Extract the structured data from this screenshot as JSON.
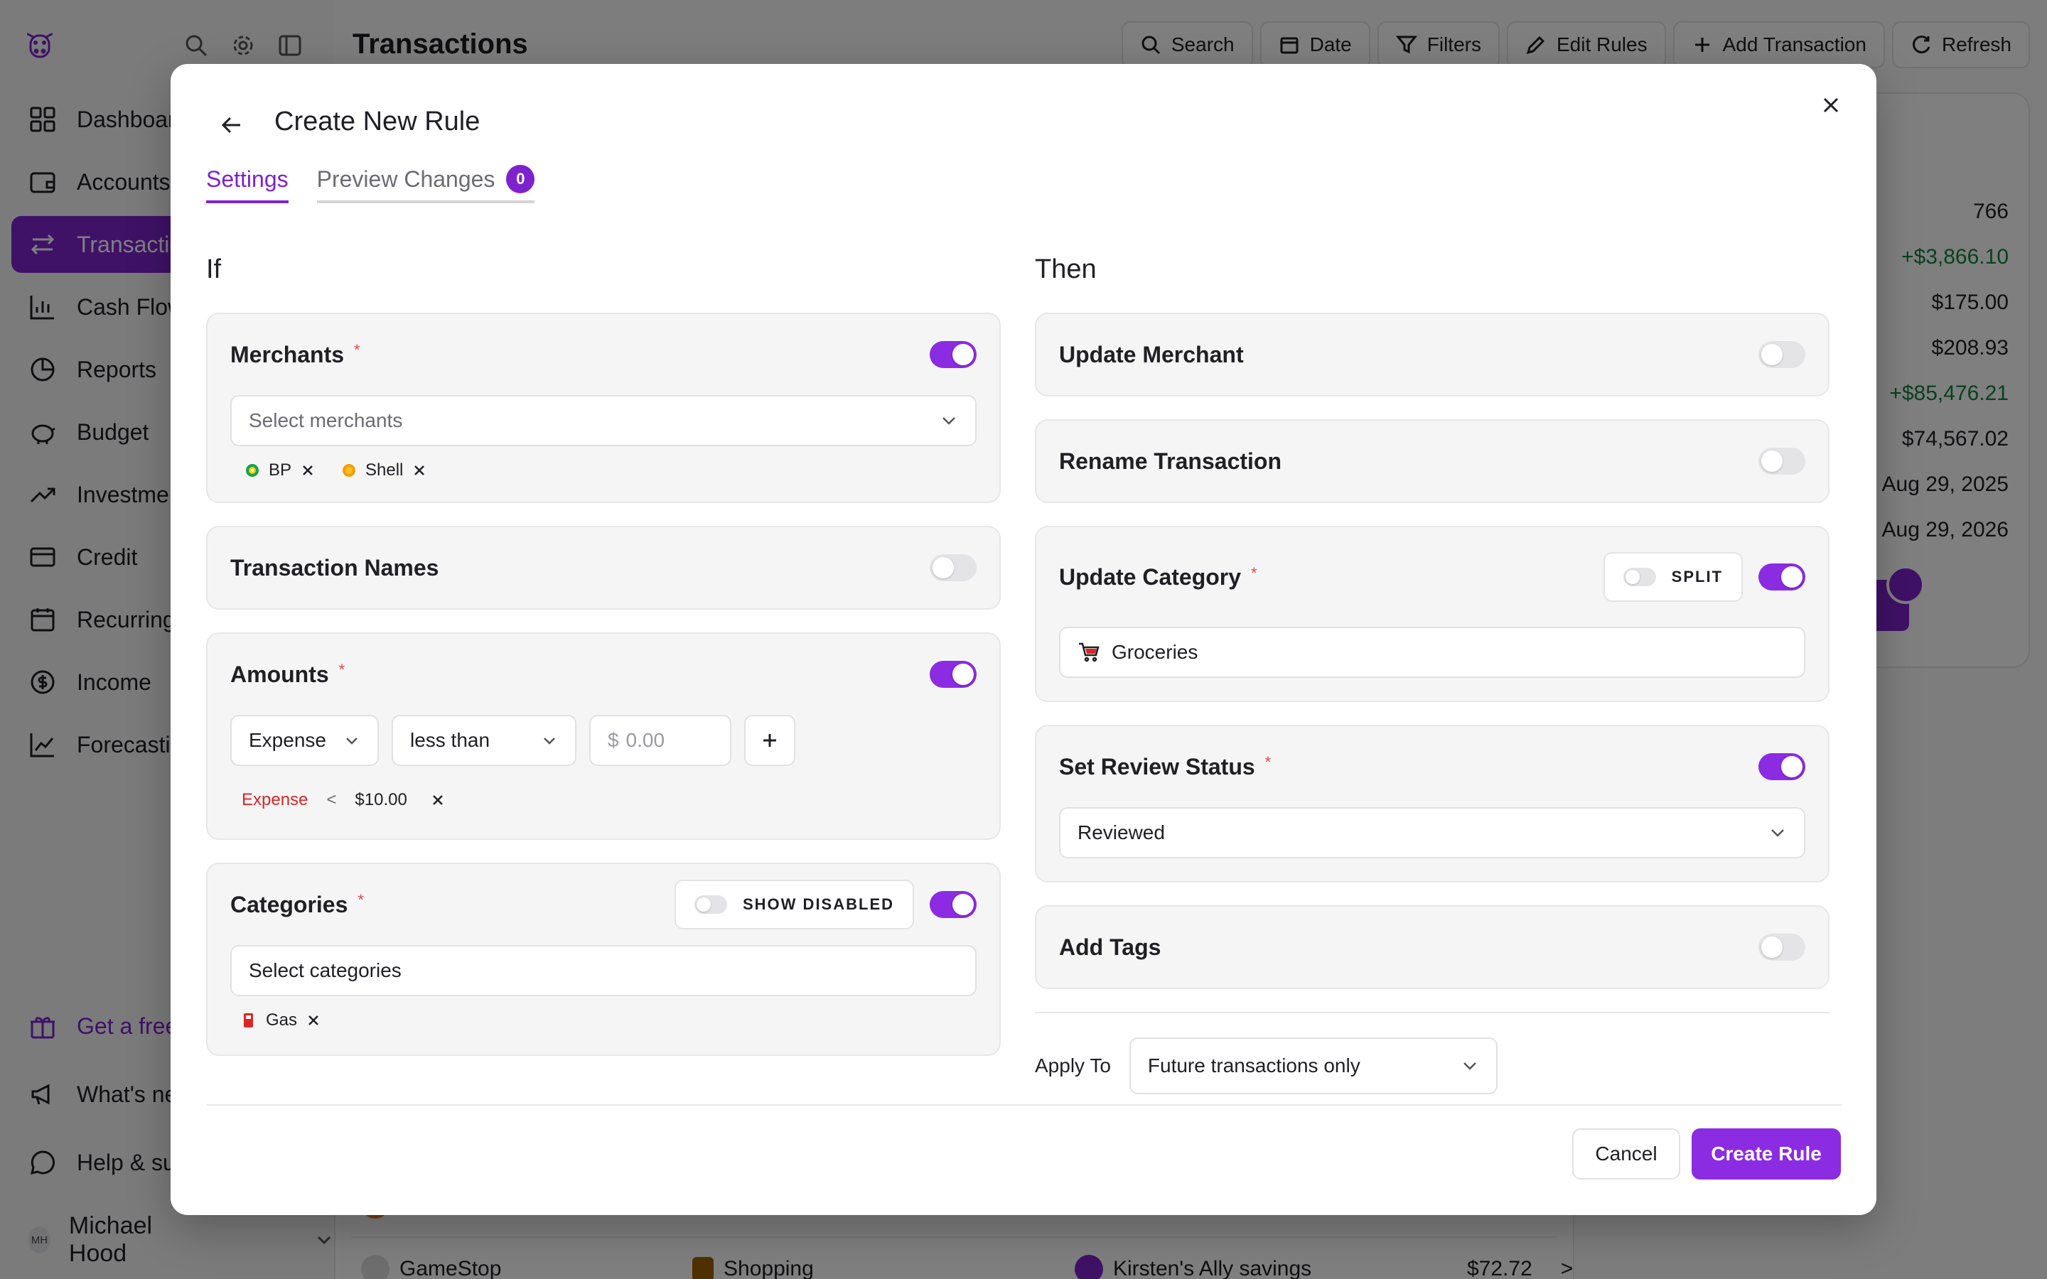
{
  "sidebar": {
    "items": [
      {
        "label": "Dashboard"
      },
      {
        "label": "Accounts"
      },
      {
        "label": "Transactions"
      },
      {
        "label": "Cash Flow"
      },
      {
        "label": "Reports"
      },
      {
        "label": "Budget"
      },
      {
        "label": "Investments"
      },
      {
        "label": "Credit"
      },
      {
        "label": "Recurring"
      },
      {
        "label": "Income"
      },
      {
        "label": "Forecasting"
      }
    ],
    "bottom": [
      {
        "label": "Get a free month"
      },
      {
        "label": "What's new"
      },
      {
        "label": "Help & support"
      }
    ],
    "user": {
      "initials": "MH",
      "name": "Michael Hood"
    }
  },
  "header": {
    "title": "Transactions",
    "actions": [
      "Search",
      "Date",
      "Filters",
      "Edit Rules",
      "Add Transaction",
      "Refresh"
    ]
  },
  "summary": {
    "values": [
      "766",
      "+$3,866.10",
      "$175.00",
      "$208.93",
      "+$85,476.21",
      "$74,567.02",
      "Aug 29, 2025",
      "Aug 29, 2026"
    ]
  },
  "bg_rows": [
    {
      "merchant": "GameStop",
      "category": "Shopping",
      "account": "Kirsten's Ally savings",
      "amount": "$72.72",
      "arrow": ">"
    }
  ],
  "modal": {
    "title": "Create New Rule",
    "tabs": {
      "settings": "Settings",
      "preview": "Preview Changes",
      "preview_count": "0"
    },
    "if_heading": "If",
    "then_heading": "Then",
    "merchants": {
      "title": "Merchants",
      "required": "*",
      "placeholder": "Select merchants",
      "chips": [
        {
          "label": "BP"
        },
        {
          "label": "Shell"
        }
      ]
    },
    "transaction_names": {
      "title": "Transaction Names"
    },
    "amounts": {
      "title": "Amounts",
      "required": "*",
      "type": "Expense",
      "operator": "less than",
      "currency": "$",
      "placeholder": "0.00",
      "condition": {
        "type": "Expense",
        "op": "<",
        "value": "$10.00"
      }
    },
    "categories": {
      "title": "Categories",
      "required": "*",
      "show_disabled": "SHOW DISABLED",
      "placeholder": "Select categories",
      "chips": [
        {
          "label": "Gas"
        }
      ]
    },
    "update_merchant": {
      "title": "Update Merchant"
    },
    "rename_transaction": {
      "title": "Rename Transaction"
    },
    "update_category": {
      "title": "Update Category",
      "required": "*",
      "split": "SPLIT",
      "value": "Groceries"
    },
    "review_status": {
      "title": "Set Review Status",
      "required": "*",
      "value": "Reviewed"
    },
    "add_tags": {
      "title": "Add Tags"
    },
    "apply_to": {
      "label": "Apply To",
      "value": "Future transactions only"
    },
    "cancel": "Cancel",
    "create": "Create Rule"
  },
  "colors": {
    "accent": "#8b2be2",
    "positive": "#15803d",
    "expense": "#dc2626",
    "required": "#e0474c"
  }
}
